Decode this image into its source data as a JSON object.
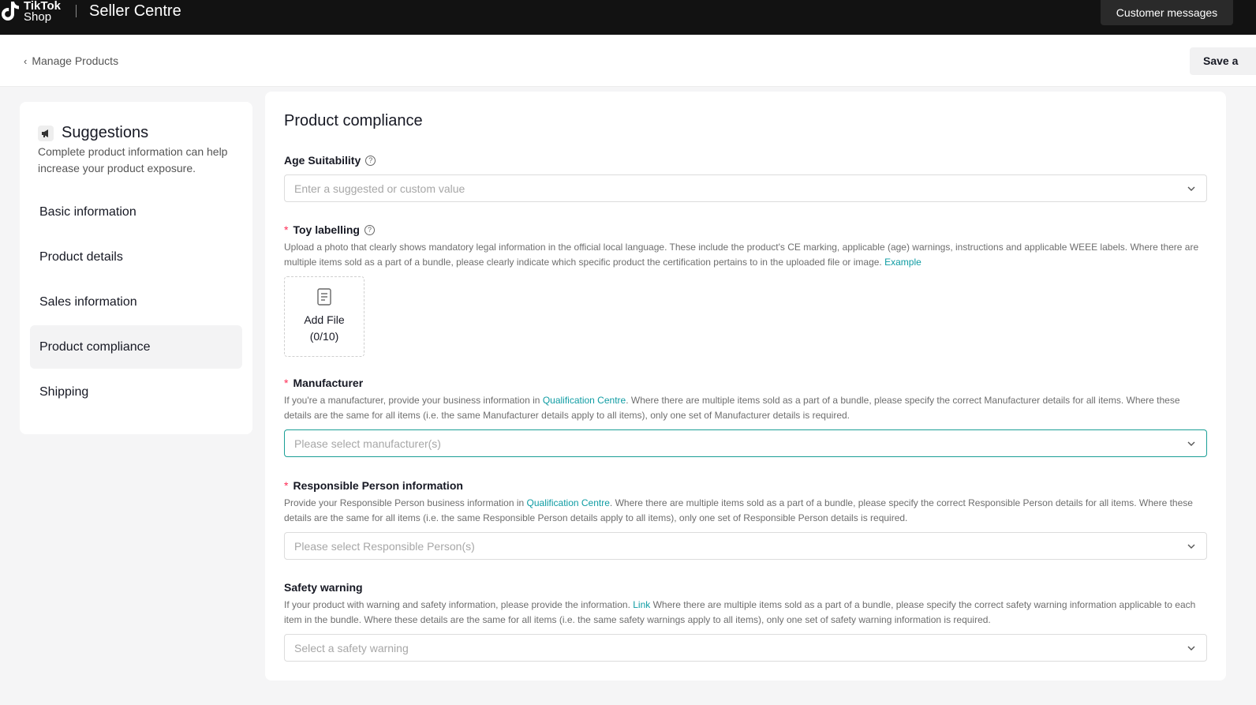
{
  "topbar": {
    "logo_line1": "TikTok",
    "logo_line2": "Shop",
    "app_title": "Seller Centre",
    "customer_messages": "Customer messages"
  },
  "subheader": {
    "back_label": "Manage Products",
    "save_label": "Save a"
  },
  "sidebar": {
    "title": "Suggestions",
    "description": "Complete product information can help increase your product exposure.",
    "items": [
      {
        "label": "Basic information"
      },
      {
        "label": "Product details"
      },
      {
        "label": "Sales information"
      },
      {
        "label": "Product compliance",
        "active": true
      },
      {
        "label": "Shipping"
      }
    ]
  },
  "main": {
    "title": "Product compliance",
    "age": {
      "label": "Age Suitability",
      "placeholder": "Enter a suggested or custom value"
    },
    "toy": {
      "label": "Toy labelling",
      "description": "Upload a photo that clearly shows mandatory legal information in the official local language. These include the product's CE marking, applicable (age) warnings, instructions and applicable WEEE labels. Where there are multiple items sold as a part of a bundle, please clearly indicate which specific product the certification pertains to in the uploaded file or image.",
      "example_link": "Example",
      "upload_label": "Add File",
      "upload_count": "(0/10)"
    },
    "manufacturer": {
      "label": "Manufacturer",
      "desc_pre": "If you're a manufacturer, provide your business information in",
      "link": "Qualification Centre",
      "desc_post": ". Where there are multiple items sold as a part of a bundle, please specify the correct Manufacturer details for all items. Where these details are the same for all items (i.e. the same Manufacturer details apply to all items), only one set of Manufacturer details is required.",
      "placeholder": "Please select manufacturer(s)"
    },
    "responsible": {
      "label": "Responsible Person information",
      "desc_pre": "Provide your Responsible Person business information in",
      "link": "Qualification Centre",
      "desc_post": ". Where there are multiple items sold as a part of a bundle, please specify the correct Responsible Person details for all items. Where these details are the same for all items (i.e. the same Responsible Person details apply to all items), only one set of Responsible Person details is required.",
      "placeholder": "Please select Responsible Person(s)"
    },
    "safety": {
      "label": "Safety warning",
      "desc_pre": "If your product with warning and safety information, please provide the information.",
      "link": "Link",
      "desc_post": " Where there are multiple items sold as a part of a bundle, please specify the correct safety warning information applicable to each item in the bundle. Where these details are the same for all items (i.e. the same safety warnings apply to all items), only one set of safety warning information is required.",
      "placeholder": "Select a safety warning"
    }
  },
  "colors": {
    "accent": "#0f9ca3",
    "required": "#fe2c55",
    "topbar": "#121212"
  }
}
